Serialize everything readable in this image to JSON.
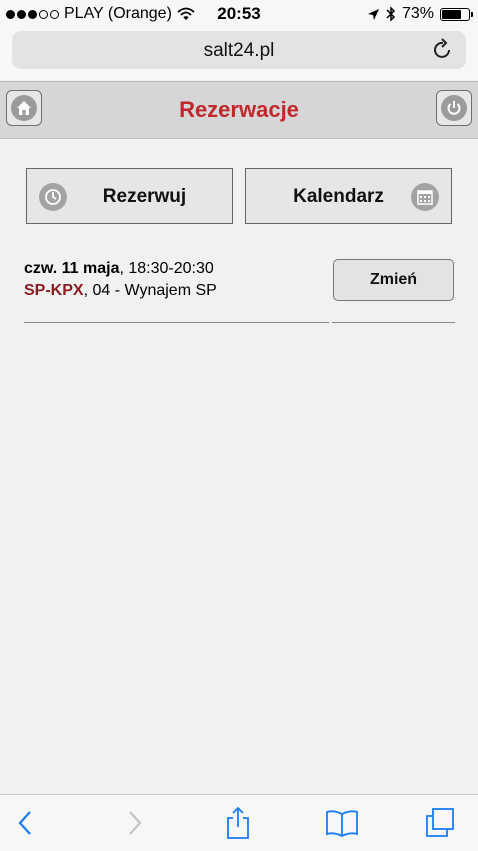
{
  "status_bar": {
    "carrier": "PLAY (Orange)",
    "time": "20:53",
    "battery_percent": "73%",
    "battery_level": 0.73,
    "icons": [
      "signal-dots-icon",
      "wifi-icon",
      "location-arrow-icon",
      "bluetooth-icon",
      "battery-icon"
    ]
  },
  "browser": {
    "url": "salt24.pl",
    "reload_icon": "reload-icon"
  },
  "header": {
    "title": "Rezerwacje",
    "left_icon": "home-icon",
    "right_icon": "power-icon",
    "title_color": "#c0282d"
  },
  "actions": {
    "reserve_label": "Rezerwuj",
    "reserve_icon": "clock-icon",
    "calendar_label": "Kalendarz",
    "calendar_icon": "calendar-icon"
  },
  "reservations": [
    {
      "date": "czw. 11 maja",
      "time": ", 18:30-20:30",
      "registration": "SP-KPX",
      "details": ", 04 - Wynajem SP",
      "change_label": "Zmień"
    }
  ],
  "colors": {
    "registration": "#8b1e22",
    "ios_blue": "#1a7cf5"
  },
  "toolbar": {
    "icons": [
      "back-icon",
      "forward-icon",
      "share-icon",
      "bookmarks-icon",
      "tabs-icon"
    ]
  }
}
